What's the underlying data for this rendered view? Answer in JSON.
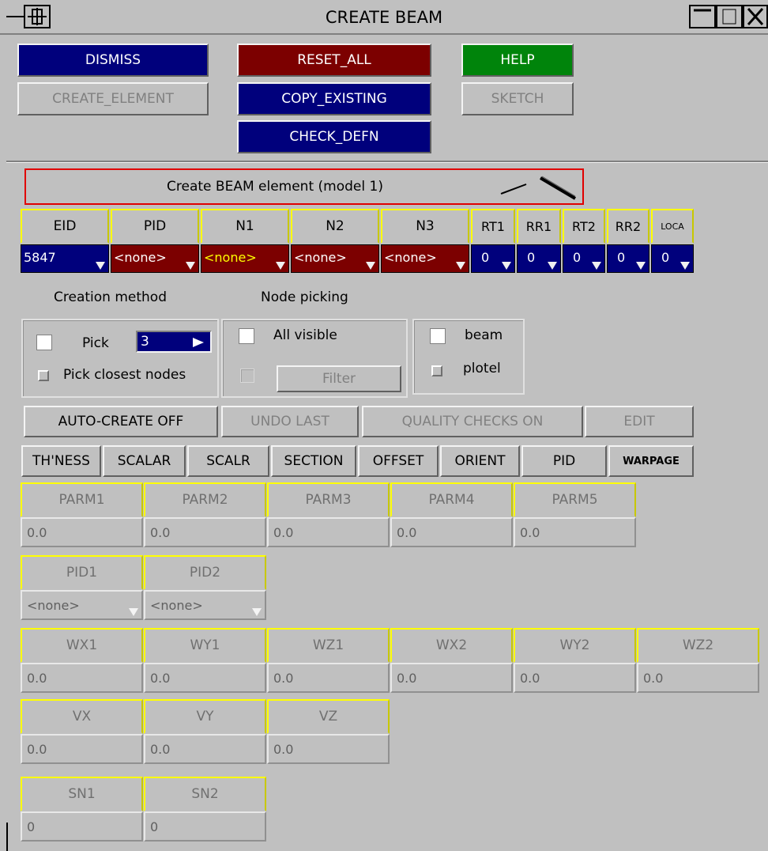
{
  "window": {
    "title": "CREATE BEAM"
  },
  "buttons": {
    "dismiss": "DISMISS",
    "reset_all": "RESET_ALL",
    "help": "HELP",
    "create_element": "CREATE_ELEMENT",
    "copy_existing": "COPY_EXISTING",
    "sketch": "SKETCH",
    "check_defn": "CHECK_DEFN"
  },
  "banner": "Create BEAM element (model 1)",
  "element_table": {
    "headers": [
      "EID",
      "PID",
      "N1",
      "N2",
      "N3",
      "RT1",
      "RR1",
      "RT2",
      "RR2",
      "LOCA"
    ],
    "values": [
      "5847",
      "<none>",
      "<none>",
      "<none>",
      "<none>",
      "0",
      "0",
      "0",
      "0",
      "0"
    ]
  },
  "section_labels": {
    "creation_method": "Creation method",
    "node_picking": "Node picking"
  },
  "creation": {
    "pick_label": "Pick",
    "pick_value": "3",
    "pick_closest": "Pick closest nodes",
    "all_visible": "All visible",
    "filter": "Filter",
    "beam": "beam",
    "plotel": "plotel"
  },
  "actions": {
    "auto_create": "AUTO-CREATE OFF",
    "undo_last": "UNDO LAST",
    "quality_checks": "QUALITY CHECKS ON",
    "edit": "EDIT"
  },
  "tabs": [
    "TH'NESS",
    "SCALAR",
    "SCALR",
    "SECTION",
    "OFFSET",
    "ORIENT",
    "PID",
    "WARPAGE"
  ],
  "parm": {
    "headers": [
      "PARM1",
      "PARM2",
      "PARM3",
      "PARM4",
      "PARM5"
    ],
    "values": [
      "0.0",
      "0.0",
      "0.0",
      "0.0",
      "0.0"
    ]
  },
  "pid": {
    "headers": [
      "PID1",
      "PID2"
    ],
    "values": [
      "<none>",
      "<none>"
    ]
  },
  "w": {
    "headers": [
      "WX1",
      "WY1",
      "WZ1",
      "WX2",
      "WY2",
      "WZ2"
    ],
    "values": [
      "0.0",
      "0.0",
      "0.0",
      "0.0",
      "0.0",
      "0.0"
    ]
  },
  "v": {
    "headers": [
      "VX",
      "VY",
      "VZ"
    ],
    "values": [
      "0.0",
      "0.0",
      "0.0"
    ]
  },
  "sn": {
    "headers": [
      "SN1",
      "SN2"
    ],
    "values": [
      "0",
      "0"
    ]
  },
  "colors": {
    "panel": "#c0c0c0",
    "blue": "#00007c",
    "red": "#7c0000",
    "green": "#00840b",
    "header_border": "#ffff00"
  }
}
